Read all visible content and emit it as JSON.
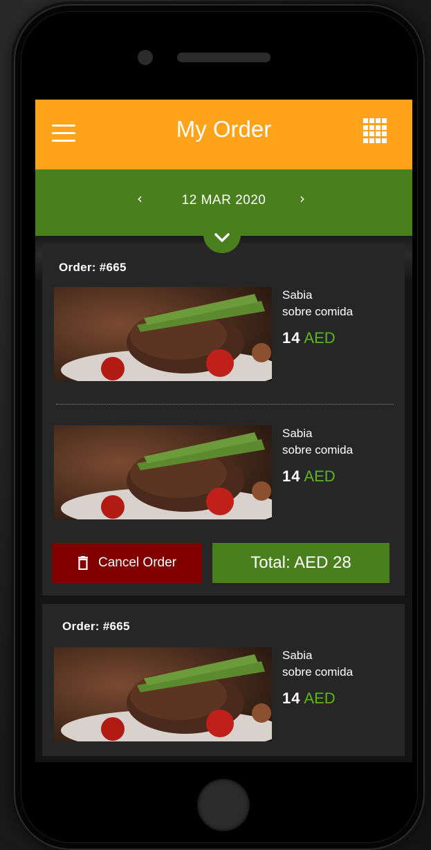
{
  "header": {
    "title": "My Order",
    "menu_icon": "hamburger-menu-icon",
    "grid_icon": "grid-apps-icon"
  },
  "date_nav": {
    "date": "12 MAR 2020",
    "prev_glyph": "‹",
    "next_glyph": "›",
    "expand_icon": "chevron-down-icon"
  },
  "orders": [
    {
      "label": "Order: #665",
      "items": [
        {
          "name_line1": "Sabia",
          "name_line2": "sobre comida",
          "price": "14",
          "currency": "AED"
        },
        {
          "name_line1": "Sabia",
          "name_line2": "sobre comida",
          "price": "14",
          "currency": "AED"
        }
      ],
      "cancel_label": "Cancel Order",
      "cancel_icon": "trash-icon",
      "total_label": "Total: AED 28"
    },
    {
      "label": "Order: #665",
      "items": [
        {
          "name_line1": "Sabia",
          "name_line2": "sobre comida",
          "price": "14",
          "currency": "AED"
        }
      ]
    }
  ],
  "colors": {
    "header": "#ffa31a",
    "date_bar": "#4a7f1e",
    "card": "#262626",
    "cancel": "#800000",
    "total": "#4a7f1e",
    "currency": "#5fb51f"
  }
}
